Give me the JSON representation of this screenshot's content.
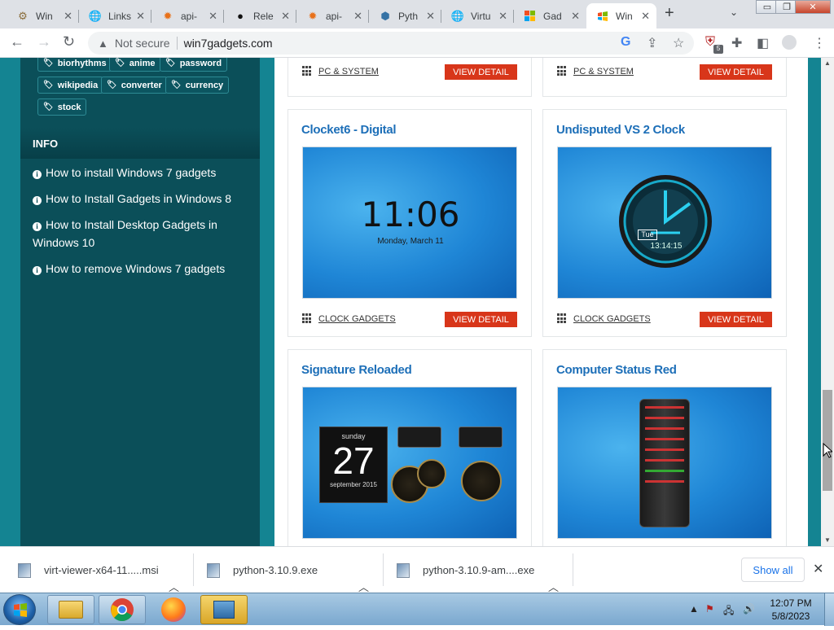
{
  "tabs": [
    {
      "label": "Win",
      "icon": "gear-colored-icon"
    },
    {
      "label": "Links",
      "icon": "globe-icon"
    },
    {
      "label": "api-",
      "icon": "gear-orange-icon"
    },
    {
      "label": "Rele",
      "icon": "github-icon"
    },
    {
      "label": "api-",
      "icon": "gear-orange-icon"
    },
    {
      "label": "Pyth",
      "icon": "python-icon"
    },
    {
      "label": "Virtu",
      "icon": "globe-icon"
    },
    {
      "label": "Gad",
      "icon": "microsoft-icon"
    },
    {
      "label": "Win",
      "icon": "windows-flag-icon",
      "active": true
    }
  ],
  "window_controls": {
    "minimize": "▭",
    "restore": "❐",
    "close": "✕"
  },
  "toolbar": {
    "security_label": "Not secure",
    "url": "win7gadgets.com",
    "extension_badge": "5"
  },
  "sidebar": {
    "tags": [
      [
        "biorhythms",
        "anime",
        "password"
      ],
      [
        "wikipedia",
        "converter",
        "currency"
      ],
      [
        "stock"
      ]
    ],
    "info_header": "INFO",
    "info_links": [
      "How to install Windows 7 gadgets",
      "How to Install Gadgets in Windows 8",
      "How to Install Desktop Gadgets in Windows 10",
      "How to remove Windows 7 gadgets"
    ]
  },
  "cards_top": [
    {
      "category": "PC & SYSTEM",
      "button": "VIEW DETAIL"
    },
    {
      "category": "PC & SYSTEM",
      "button": "VIEW DETAIL"
    }
  ],
  "cards": [
    {
      "title": "Clocket6 - Digital",
      "category": "CLOCK GADGETS",
      "button": "VIEW DETAIL",
      "clock_time": "11:06",
      "clock_date": "Monday, March 11"
    },
    {
      "title": "Undisputed VS 2 Clock",
      "category": "CLOCK GADGETS",
      "button": "VIEW DETAIL",
      "day": "Tue",
      "time": "13:14:15"
    },
    {
      "title": "Signature Reloaded",
      "day_name": "sunday",
      "day_num": "27",
      "month_year": "september 2015"
    },
    {
      "title": "Computer Status Red"
    }
  ],
  "downloads": [
    {
      "name": "virt-viewer-x64-11.....msi"
    },
    {
      "name": "python-3.10.9.exe"
    },
    {
      "name": "python-3.10.9-am....exe"
    }
  ],
  "downloads_show_all": "Show all",
  "taskbar": {
    "time": "12:07 PM",
    "date": "5/8/2023"
  },
  "colors": {
    "page_bg": "#148492",
    "sidebar_bg": "#0b4f59",
    "title_blue": "#1d6fb8",
    "button_red": "#d8361a"
  }
}
